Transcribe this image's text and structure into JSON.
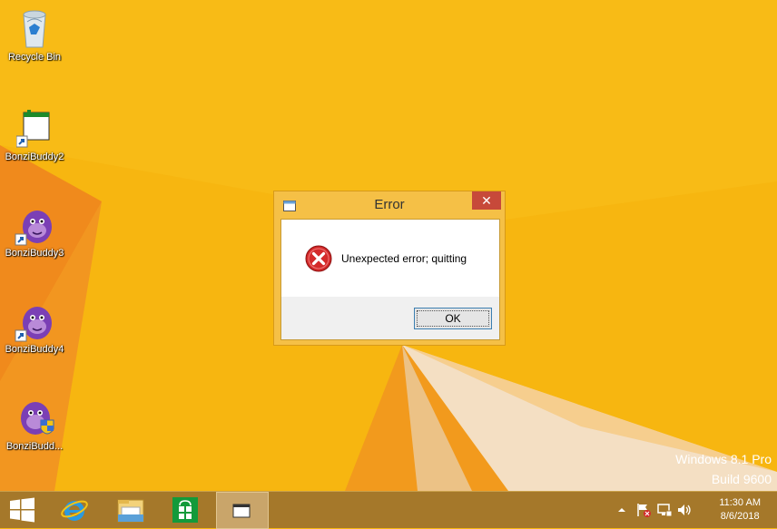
{
  "desktop": {
    "icons": [
      {
        "label": "Recycle Bin",
        "icon": "recycle-bin-icon"
      },
      {
        "label": "BonziBuddy2",
        "icon": "program-window-icon"
      },
      {
        "label": "BonziBuddy3",
        "icon": "bonzi-gorilla-icon"
      },
      {
        "label": "BonziBuddy4",
        "icon": "bonzi-gorilla-icon"
      },
      {
        "label": "BonziBudd...",
        "icon": "bonzi-gorilla-shield-icon"
      }
    ],
    "watermark": {
      "line1": "Windows 8.1 Pro",
      "line2": "Build 9600"
    }
  },
  "dialog": {
    "title": "Error",
    "close_glyph": "✕",
    "message": "Unexpected error; quitting",
    "ok_label": "OK",
    "icon": "error-icon"
  },
  "taskbar": {
    "buttons": [
      "start-button",
      "internet-explorer",
      "file-explorer",
      "windows-store",
      "running-app"
    ],
    "clock": {
      "time": "11:30 AM",
      "date": "8/6/2018"
    },
    "tray_icons": [
      "show-hidden-icons",
      "action-center-icon",
      "network-icon",
      "volume-icon"
    ]
  },
  "colors": {
    "accent": "#f7b610",
    "taskbar": "#a5782a",
    "close_button": "#c7493a",
    "error_red": "#d42a2a"
  }
}
